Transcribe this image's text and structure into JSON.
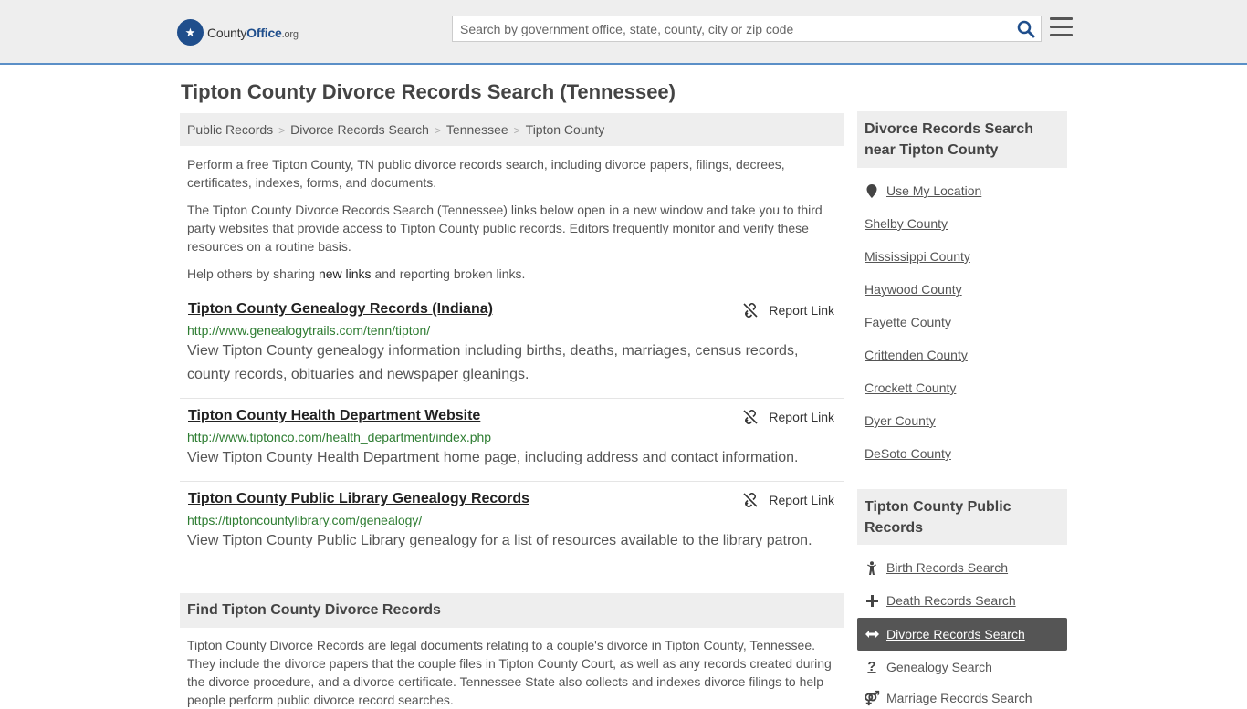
{
  "header": {
    "logo_county": "County",
    "logo_office": "Office",
    "logo_org": ".org",
    "search_placeholder": "Search by government office, state, county, city or zip code"
  },
  "page": {
    "title": "Tipton County Divorce Records Search (Tennessee)"
  },
  "breadcrumb": [
    "Public Records",
    "Divorce Records Search",
    "Tennessee",
    "Tipton County"
  ],
  "intro": {
    "p1": "Perform a free Tipton County, TN public divorce records search, including divorce papers, filings, decrees, certificates, indexes, forms, and documents.",
    "p2": "The Tipton County Divorce Records Search (Tennessee) links below open in a new window and take you to third party websites that provide access to Tipton County public records. Editors frequently monitor and verify these resources on a routine basis.",
    "p3_before": "Help others by sharing ",
    "p3_link": "new links",
    "p3_after": " and reporting broken links."
  },
  "report_label": "Report Link",
  "results": [
    {
      "title": "Tipton County Genealogy Records (Indiana)",
      "url": "http://www.genealogytrails.com/tenn/tipton/",
      "desc": "View Tipton County genealogy information including births, deaths, marriages, census records, county records, obituaries and newspaper gleanings."
    },
    {
      "title": "Tipton County Health Department Website",
      "url": "http://www.tiptonco.com/health_department/index.php",
      "desc": "View Tipton County Health Department home page, including address and contact information."
    },
    {
      "title": "Tipton County Public Library Genealogy Records",
      "url": "https://tiptoncountylibrary.com/genealogy/",
      "desc": "View Tipton County Public Library genealogy for a list of resources available to the library patron."
    }
  ],
  "find_section": {
    "heading": "Find Tipton County Divorce Records",
    "body": "Tipton County Divorce Records are legal documents relating to a couple's divorce in Tipton County, Tennessee. They include the divorce papers that the couple files in Tipton County Court, as well as any records created during the divorce procedure, and a divorce certificate. Tennessee State also collects and indexes divorce filings to help people perform public divorce record searches."
  },
  "sidebar": {
    "nearby_heading": "Divorce Records Search near Tipton County",
    "use_location": "Use My Location",
    "nearby": [
      "Shelby County",
      "Mississippi County",
      "Haywood County",
      "Fayette County",
      "Crittenden County",
      "Crockett County",
      "Dyer County",
      "DeSoto County"
    ],
    "public_heading": "Tipton County Public Records",
    "public_links": [
      {
        "label": "Birth Records Search",
        "icon": "child-icon"
      },
      {
        "label": "Death Records Search",
        "icon": "cross-icon"
      },
      {
        "label": "Divorce Records Search",
        "icon": "arrows-icon"
      },
      {
        "label": "Genealogy Search",
        "icon": "question-icon"
      },
      {
        "label": "Marriage Records Search",
        "icon": "gender-icon"
      }
    ]
  },
  "colors": {
    "header_bg": "#eeeeee",
    "header_border": "#5b8fc7",
    "url_green": "#2e7d32",
    "active_bg": "#555555",
    "brand_blue": "#1f4e8c"
  }
}
